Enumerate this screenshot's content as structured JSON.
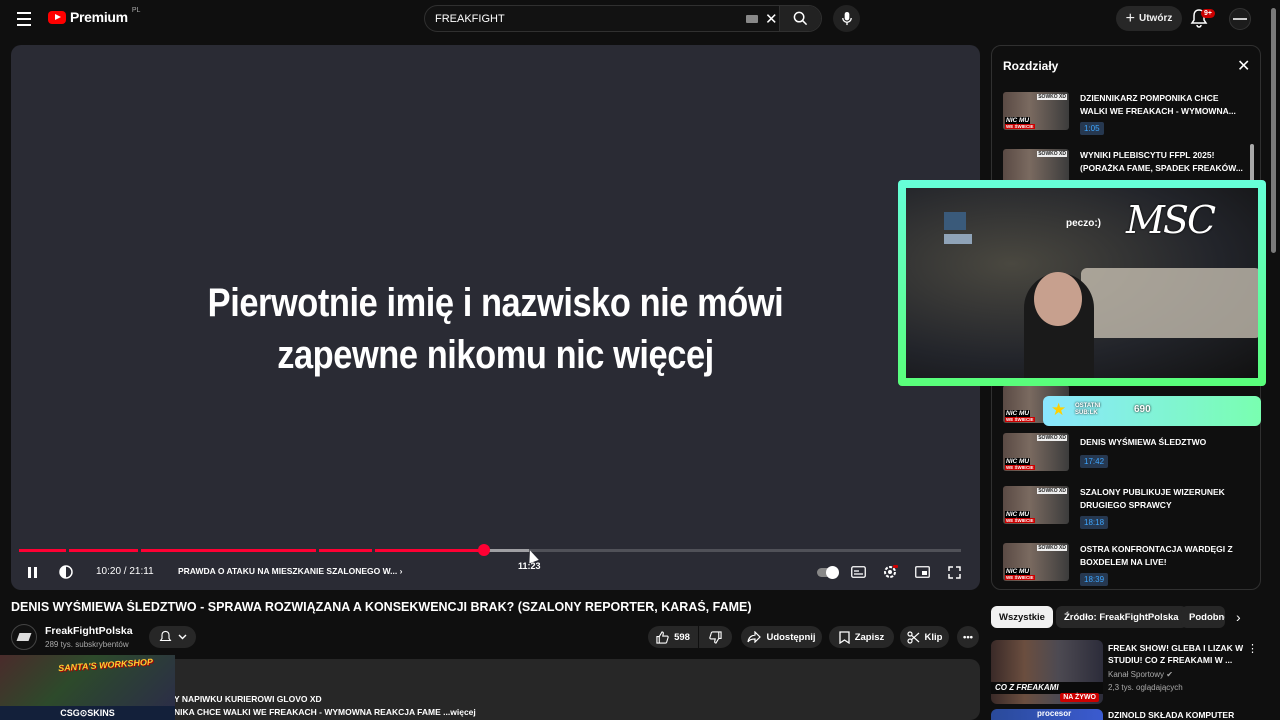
{
  "header": {
    "logo_text": "Premium",
    "logo_country": "PL",
    "search_value": "FREAKFIGHT",
    "create_label": "Utwórz",
    "notifications_badge": "9+"
  },
  "player": {
    "subtitle_line1": "Pierwotnie imię i nazwisko nie mówi",
    "subtitle_line2": "zapewne nikomu nic więcej",
    "hover_time": "11:23",
    "time_display": "10:20 / 21:11",
    "current_chapter": "PRAWDA O ATAKU NA MIESZKANIE SZALONEGO W...",
    "progress_fraction": 0.4875,
    "duration": "21:11"
  },
  "video": {
    "title": "DENIS WYŚMIEWA ŚLEDZTWO - SPRAWA ROZWIĄZANA A KONSEKWENCJI BRAK? (SZALONY REPORTER, KARAŚ, FAME)",
    "channel_name": "FreakFightPolska",
    "subscribers": "289 tys. subskrybentów",
    "like_count": "598",
    "share_label": "Udostępnij",
    "save_label": "Zapisz",
    "clip_label": "Klip",
    "desc_line1": "Y NAPIWKU KURIEROWI GLOVO XD",
    "desc_line2": "NIKA CHCE WALKI WE FREAKACH - WYMOWNA REAKCJA FAME",
    "desc_more": "...więcej"
  },
  "ad": {
    "title": "SANTA'S WORKSHOP",
    "footer": "CSG⊙SKINS"
  },
  "chapters": {
    "title": "Rozdziały",
    "items": [
      {
        "title": "DZIENNIKARZ POMPONIKA CHCE WALKI WE FREAKACH - WYMOWNA...",
        "time": "1:05"
      },
      {
        "title": "WYNIKI PLEBISCYTU FFPL 2025! (PORAŻKA FAME, SPADEK FREAKÓW...",
        "time": ""
      },
      {
        "title": "DENIS WYŚMIEWA ŚLEDZTWO",
        "time": "17:42"
      },
      {
        "title": "SZALONY PUBLIKUJE WIZERUNEK DRUGIEGO SPRAWCY",
        "time": "18:18"
      },
      {
        "title": "OSTRA KONFRONTACJA WARDĘGI Z BOXDELEM NA LIVE!",
        "time": "18:39"
      }
    ],
    "thumb_tag": "SOWKO XD",
    "thumb_caption": "NIC MU",
    "thumb_caption2": "WE ŚWIECIE"
  },
  "stream_overlay": {
    "logo": "MSC",
    "small_text": "peczo:)",
    "last_sub_label_1": "OSTATNI",
    "last_sub_label_2": "SUB:LK",
    "last_sub_value": "690"
  },
  "filters": {
    "all": "Wszystkie",
    "source": "Źródło: FreakFightPolska",
    "similar": "Podobne"
  },
  "recommendations": [
    {
      "title": "FREAK SHOW! GLEBA I LIZAK W STUDIU! CO Z FREAKAMI W ...",
      "channel": "Kanał Sportowy",
      "views": "2,3 tys. oglądających",
      "thumb_text": "CO Z FREAKAMI",
      "live_label": "NA ŻYWO"
    },
    {
      "title": "DZINOLD SKŁADA KOMPUTER",
      "thumb_text": "procesor"
    }
  ]
}
